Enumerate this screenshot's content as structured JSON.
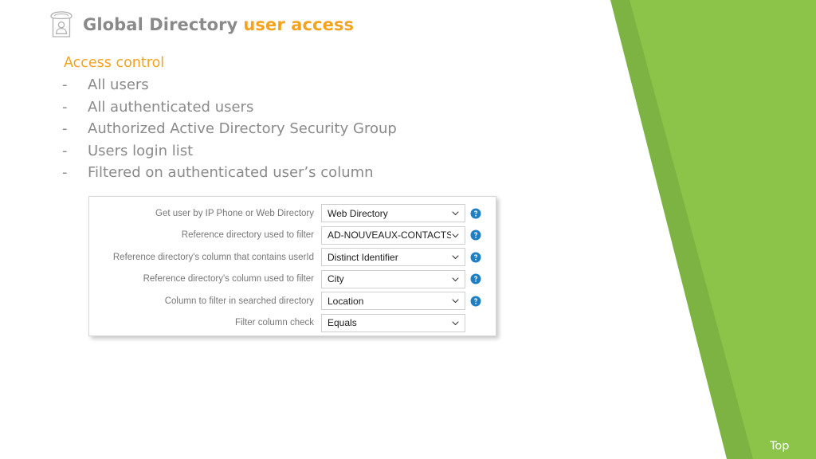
{
  "slide": {
    "title_main": "Global Directory",
    "title_accent": "user access",
    "title_icon": "directory-phone-person-icon",
    "background_color": "#ffffff",
    "accent_color": "#f5a21c",
    "muted_text_color": "#8a8a8a",
    "green_light": "#8cc44a",
    "green_dark": "#7cb342"
  },
  "content": {
    "section_heading": "Access control",
    "bullet_marker": "-",
    "bullets": [
      {
        "label": "All users"
      },
      {
        "label": "All authenticated users"
      },
      {
        "label": "Authorized Active Directory Security Group"
      },
      {
        "label": "Users login list"
      },
      {
        "label": "Filtered on authenticated user’s column"
      }
    ]
  },
  "settings_panel": {
    "help_icon": "question-mark-circle-icon",
    "dropdown_icon": "chevron-down-icon",
    "rows": [
      {
        "label": "Get user by IP Phone or Web Directory",
        "value": "Web Directory",
        "has_help": true
      },
      {
        "label": "Reference directory used to filter",
        "value": "AD-NOUVEAUX-CONTACTS",
        "has_help": true
      },
      {
        "label": "Reference directory's column that contains userId",
        "value": "Distinct Identifier",
        "has_help": true
      },
      {
        "label": "Reference directory's column used to filter",
        "value": "City",
        "has_help": true
      },
      {
        "label": "Column to filter in searched directory",
        "value": "Location",
        "has_help": true
      },
      {
        "label": "Filter column check",
        "value": "Equals",
        "has_help": false
      }
    ]
  },
  "footer": {
    "top_link": "Top"
  }
}
